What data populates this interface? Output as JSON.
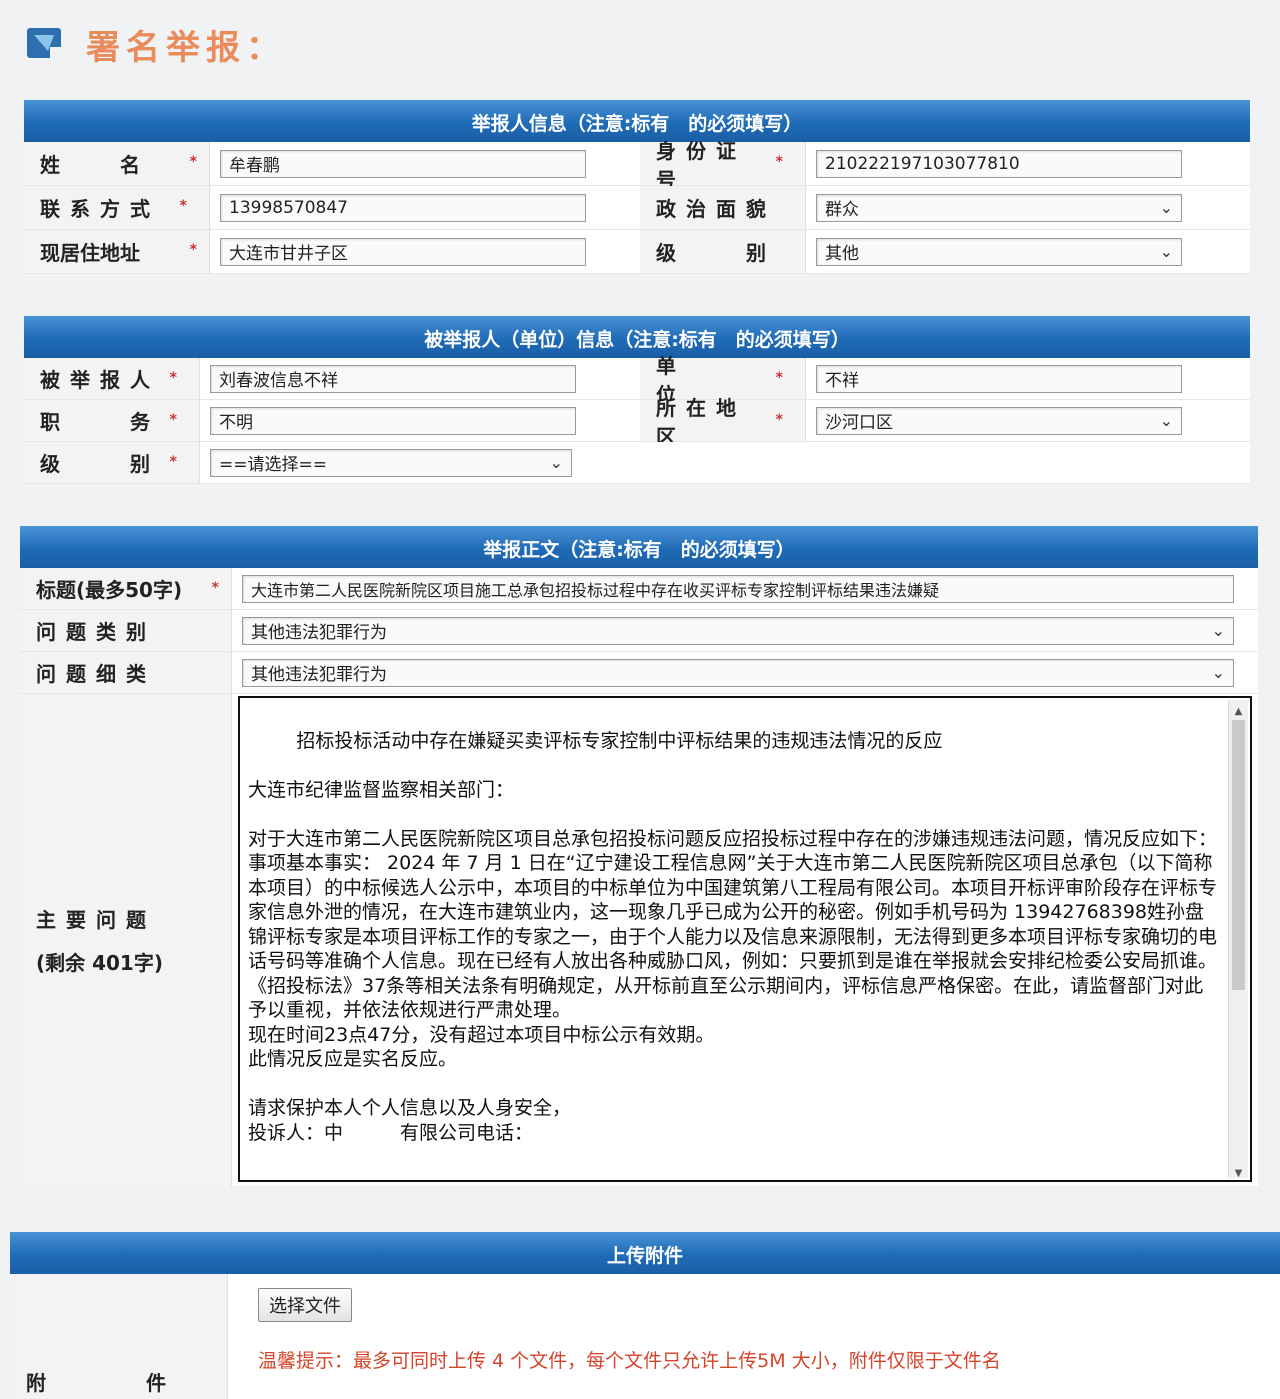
{
  "header": {
    "title": "署名举报："
  },
  "reporter": {
    "bar_title": "举报人信息（注意:标有　的必须填写）",
    "name_label": "姓　　　名",
    "name_value": "牟春鹏",
    "id_label": "身份证号",
    "id_value": "210222197103077810",
    "contact_label": "联系方式",
    "contact_value": "13998570847",
    "political_label": "政治面貌",
    "political_value": "群众",
    "address_label": "现居住地址",
    "address_value": "大连市甘井子区",
    "level_label": "级　　别",
    "level_value": "其他"
  },
  "accused": {
    "bar_title": "被举报人（单位）信息（注意:标有　的必须填写）",
    "person_label": "被举报人",
    "person_value": "刘春波信息不祥",
    "unit_label": "单　　位",
    "unit_value": "不祥",
    "duty_label": "职　　务",
    "duty_value": "不明",
    "region_label": "所在地区",
    "region_value": "沙河口区",
    "level_label": "级　　别",
    "level_value": "==请选择=="
  },
  "report": {
    "bar_title": "举报正文（注意:标有　的必须填写）",
    "title_label": "标题(最多50字)",
    "title_value": "大连市第二人民医院新院区项目施工总承包招投标过程中存在收买评标专家控制评标结果违法嫌疑",
    "category_label": "问题类别",
    "category_value": "其他违法犯罪行为",
    "subcategory_label": "问题细类",
    "subcategory_value": "其他违法犯罪行为",
    "main_label": "主要问题",
    "remaining": "(剩余 401字)",
    "body": "招标投标活动中存在嫌疑买卖评标专家控制中评标结果的违规违法情况的反应\n\n大连市纪律监督监察相关部门：\n\n对于大连市第二人民医院新院区项目总承包招投标问题反应招投标过程中存在的涉嫌违规违法问题，情况反应如下：\n事项基本事实： 2024 年 7 月 1 日在“辽宁建设工程信息网”关于大连市第二人民医院新院区项目总承包（以下简称本项目）的中标候选人公示中，本项目的中标单位为中国建筑第八工程局有限公司。本项目开标评审阶段存在评标专家信息外泄的情况，在大连市建筑业内，这一现象几乎已成为公开的秘密。例如手机号码为 13942768398姓孙盘锦评标专家是本项目评标工作的专家之一，由于个人能力以及信息来源限制，无法得到更多本项目评标专家确切的电话号码等准确个人信息。现在已经有人放出各种威胁口风，例如：只要抓到是谁在举报就会安排纪检委公安局抓谁。《招投标法》37条等相关法条有明确规定，从开标前直至公示期间内，评标信息严格保密。在此，请监督部门对此予以重视，并依法依规进行严肃处理。\n现在时间23点47分，没有超过本项目中标公示有效期。\n此情况反应是实名反应。\n\n请求保护本人个人信息以及人身安全，\n投诉人：中　　　有限公司电话："
  },
  "upload": {
    "bar_title": "上传附件",
    "button_label": "选择文件",
    "attach_label": "附　　　　　件",
    "hint": "温馨提示：最多可同时上传 4 个文件，每个文件只允许上传5M 大小，附件仅限于文件名"
  }
}
